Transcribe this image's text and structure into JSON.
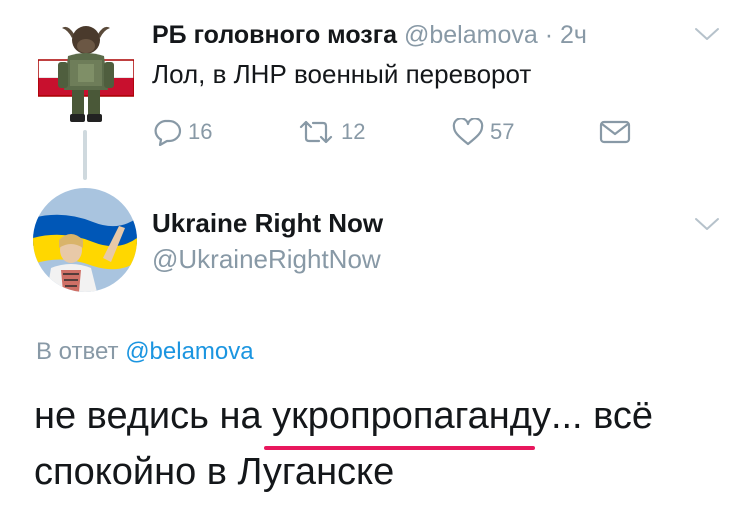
{
  "tweet1": {
    "display_name": "РБ головного мозга",
    "handle": "@belamova",
    "separator": "·",
    "time": "2ч",
    "text": "Лол, в ЛНР военный переворот",
    "actions": {
      "reply_count": "16",
      "retweet_count": "12",
      "like_count": "57"
    },
    "avatar_flag_colors": [
      "#ffffff",
      "#c8102e"
    ]
  },
  "tweet2": {
    "display_name": "Ukraine Right Now",
    "handle": "@UkraineRightNow",
    "reply_prefix": "В ответ",
    "reply_mention": "@belamova",
    "text_before": "не ведись на ",
    "text_underlined": "укропропаганду",
    "text_after": "... всё спокойно в Луганске",
    "avatar_flag_colors": [
      "#0057b7",
      "#ffd700"
    ]
  },
  "icons": {
    "reply": "reply-icon",
    "retweet": "retweet-icon",
    "like": "heart-icon",
    "message": "envelope-icon",
    "menu": "chevron-down-icon"
  },
  "colors": {
    "text_primary": "#14171a",
    "text_secondary": "#8899a6",
    "link": "#1b95e0",
    "annotation_underline": "#e8175d"
  }
}
